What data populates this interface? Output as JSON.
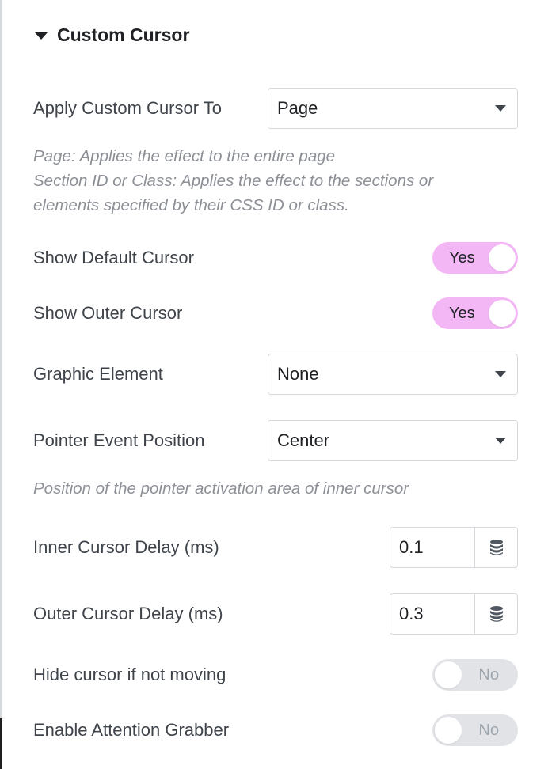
{
  "section": {
    "title": "Custom Cursor"
  },
  "apply_to": {
    "label": "Apply Custom Cursor To",
    "value": "Page",
    "help_lines": [
      "Page: Applies the effect to the entire page",
      "Section ID or Class: Applies the effect to the sections or",
      "elements specified by their CSS ID or class."
    ]
  },
  "show_default_cursor": {
    "label": "Show Default Cursor",
    "state_text": "Yes",
    "on": true
  },
  "show_outer_cursor": {
    "label": "Show Outer Cursor",
    "state_text": "Yes",
    "on": true
  },
  "graphic_element": {
    "label": "Graphic Element",
    "value": "None"
  },
  "pointer_event_position": {
    "label": "Pointer Event Position",
    "value": "Center",
    "help": "Position of the pointer activation area of inner cursor"
  },
  "inner_cursor_delay": {
    "label": "Inner Cursor Delay (ms)",
    "value": "0.1"
  },
  "outer_cursor_delay": {
    "label": "Outer Cursor Delay (ms)",
    "value": "0.3"
  },
  "hide_cursor": {
    "label": "Hide cursor if not moving",
    "state_text": "No",
    "on": false
  },
  "attention_grabber": {
    "label": "Enable Attention Grabber",
    "state_text": "No",
    "on": false
  },
  "colors": {
    "toggle_on": "#f4b7f6",
    "toggle_off": "#e1e3e6",
    "help_text": "#8c9096",
    "label_text": "#3f444b"
  },
  "icons": {
    "section_caret": "caret-down-icon",
    "select_arrow": "chevron-down-icon",
    "dynamic_tags": "database-icon"
  }
}
